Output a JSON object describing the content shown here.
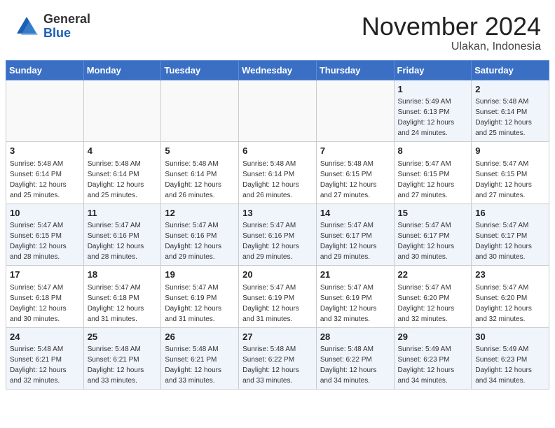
{
  "header": {
    "logo_general": "General",
    "logo_blue": "Blue",
    "title": "November 2024",
    "subtitle": "Ulakan, Indonesia"
  },
  "days_of_week": [
    "Sunday",
    "Monday",
    "Tuesday",
    "Wednesday",
    "Thursday",
    "Friday",
    "Saturday"
  ],
  "weeks": [
    [
      {
        "day": "",
        "info": ""
      },
      {
        "day": "",
        "info": ""
      },
      {
        "day": "",
        "info": ""
      },
      {
        "day": "",
        "info": ""
      },
      {
        "day": "",
        "info": ""
      },
      {
        "day": "1",
        "info": "Sunrise: 5:49 AM\nSunset: 6:13 PM\nDaylight: 12 hours\nand 24 minutes."
      },
      {
        "day": "2",
        "info": "Sunrise: 5:48 AM\nSunset: 6:14 PM\nDaylight: 12 hours\nand 25 minutes."
      }
    ],
    [
      {
        "day": "3",
        "info": "Sunrise: 5:48 AM\nSunset: 6:14 PM\nDaylight: 12 hours\nand 25 minutes."
      },
      {
        "day": "4",
        "info": "Sunrise: 5:48 AM\nSunset: 6:14 PM\nDaylight: 12 hours\nand 25 minutes."
      },
      {
        "day": "5",
        "info": "Sunrise: 5:48 AM\nSunset: 6:14 PM\nDaylight: 12 hours\nand 26 minutes."
      },
      {
        "day": "6",
        "info": "Sunrise: 5:48 AM\nSunset: 6:14 PM\nDaylight: 12 hours\nand 26 minutes."
      },
      {
        "day": "7",
        "info": "Sunrise: 5:48 AM\nSunset: 6:15 PM\nDaylight: 12 hours\nand 27 minutes."
      },
      {
        "day": "8",
        "info": "Sunrise: 5:47 AM\nSunset: 6:15 PM\nDaylight: 12 hours\nand 27 minutes."
      },
      {
        "day": "9",
        "info": "Sunrise: 5:47 AM\nSunset: 6:15 PM\nDaylight: 12 hours\nand 27 minutes."
      }
    ],
    [
      {
        "day": "10",
        "info": "Sunrise: 5:47 AM\nSunset: 6:15 PM\nDaylight: 12 hours\nand 28 minutes."
      },
      {
        "day": "11",
        "info": "Sunrise: 5:47 AM\nSunset: 6:16 PM\nDaylight: 12 hours\nand 28 minutes."
      },
      {
        "day": "12",
        "info": "Sunrise: 5:47 AM\nSunset: 6:16 PM\nDaylight: 12 hours\nand 29 minutes."
      },
      {
        "day": "13",
        "info": "Sunrise: 5:47 AM\nSunset: 6:16 PM\nDaylight: 12 hours\nand 29 minutes."
      },
      {
        "day": "14",
        "info": "Sunrise: 5:47 AM\nSunset: 6:17 PM\nDaylight: 12 hours\nand 29 minutes."
      },
      {
        "day": "15",
        "info": "Sunrise: 5:47 AM\nSunset: 6:17 PM\nDaylight: 12 hours\nand 30 minutes."
      },
      {
        "day": "16",
        "info": "Sunrise: 5:47 AM\nSunset: 6:17 PM\nDaylight: 12 hours\nand 30 minutes."
      }
    ],
    [
      {
        "day": "17",
        "info": "Sunrise: 5:47 AM\nSunset: 6:18 PM\nDaylight: 12 hours\nand 30 minutes."
      },
      {
        "day": "18",
        "info": "Sunrise: 5:47 AM\nSunset: 6:18 PM\nDaylight: 12 hours\nand 31 minutes."
      },
      {
        "day": "19",
        "info": "Sunrise: 5:47 AM\nSunset: 6:19 PM\nDaylight: 12 hours\nand 31 minutes."
      },
      {
        "day": "20",
        "info": "Sunrise: 5:47 AM\nSunset: 6:19 PM\nDaylight: 12 hours\nand 31 minutes."
      },
      {
        "day": "21",
        "info": "Sunrise: 5:47 AM\nSunset: 6:19 PM\nDaylight: 12 hours\nand 32 minutes."
      },
      {
        "day": "22",
        "info": "Sunrise: 5:47 AM\nSunset: 6:20 PM\nDaylight: 12 hours\nand 32 minutes."
      },
      {
        "day": "23",
        "info": "Sunrise: 5:47 AM\nSunset: 6:20 PM\nDaylight: 12 hours\nand 32 minutes."
      }
    ],
    [
      {
        "day": "24",
        "info": "Sunrise: 5:48 AM\nSunset: 6:21 PM\nDaylight: 12 hours\nand 32 minutes."
      },
      {
        "day": "25",
        "info": "Sunrise: 5:48 AM\nSunset: 6:21 PM\nDaylight: 12 hours\nand 33 minutes."
      },
      {
        "day": "26",
        "info": "Sunrise: 5:48 AM\nSunset: 6:21 PM\nDaylight: 12 hours\nand 33 minutes."
      },
      {
        "day": "27",
        "info": "Sunrise: 5:48 AM\nSunset: 6:22 PM\nDaylight: 12 hours\nand 33 minutes."
      },
      {
        "day": "28",
        "info": "Sunrise: 5:48 AM\nSunset: 6:22 PM\nDaylight: 12 hours\nand 34 minutes."
      },
      {
        "day": "29",
        "info": "Sunrise: 5:49 AM\nSunset: 6:23 PM\nDaylight: 12 hours\nand 34 minutes."
      },
      {
        "day": "30",
        "info": "Sunrise: 5:49 AM\nSunset: 6:23 PM\nDaylight: 12 hours\nand 34 minutes."
      }
    ]
  ]
}
